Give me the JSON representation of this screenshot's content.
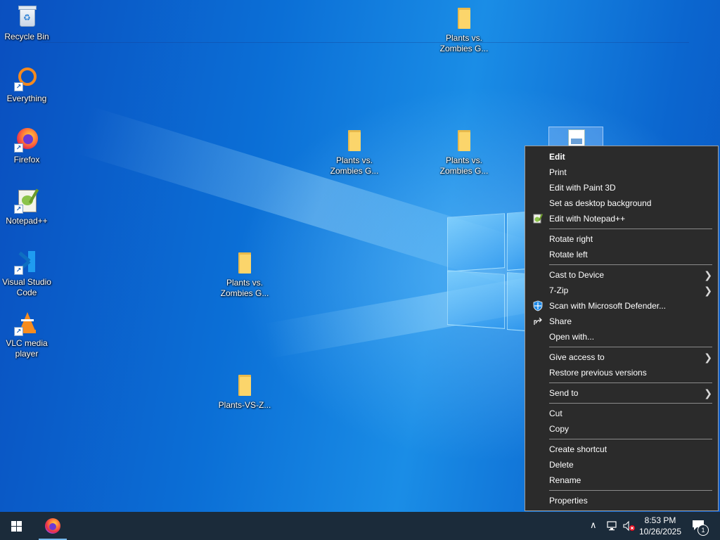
{
  "desktop": {
    "icons": [
      {
        "label": "Recycle Bin"
      },
      {
        "label": "Everything"
      },
      {
        "label": "Firefox"
      },
      {
        "label": "Notepad++"
      },
      {
        "label": "Visual Studio Code"
      },
      {
        "label": "VLC media player"
      },
      {
        "label": "Plants vs. Zombies G..."
      },
      {
        "label": "Plants vs. Zombies G..."
      },
      {
        "label": "Plants vs. Zombies G..."
      },
      {
        "label": "Plants vs. Zombies G..."
      },
      {
        "label": "Plants-VS-Z..."
      }
    ]
  },
  "context_menu": {
    "items": [
      "Edit",
      "Print",
      "Edit with Paint 3D",
      "Set as desktop background",
      "Edit with Notepad++",
      "Rotate right",
      "Rotate left",
      "Cast to Device",
      "7-Zip",
      "Scan with Microsoft Defender...",
      "Share",
      "Open with...",
      "Give access to",
      "Restore previous versions",
      "Send to",
      "Cut",
      "Copy",
      "Create shortcut",
      "Delete",
      "Rename",
      "Properties"
    ]
  },
  "taskbar": {
    "time": "8:53 PM",
    "date": "10/26/2025",
    "notification_count": "1"
  },
  "colors": {
    "menu_bg": "#2b2b2b",
    "taskbar_bg": "#1b2b3a",
    "accent": "#76b9ed"
  }
}
